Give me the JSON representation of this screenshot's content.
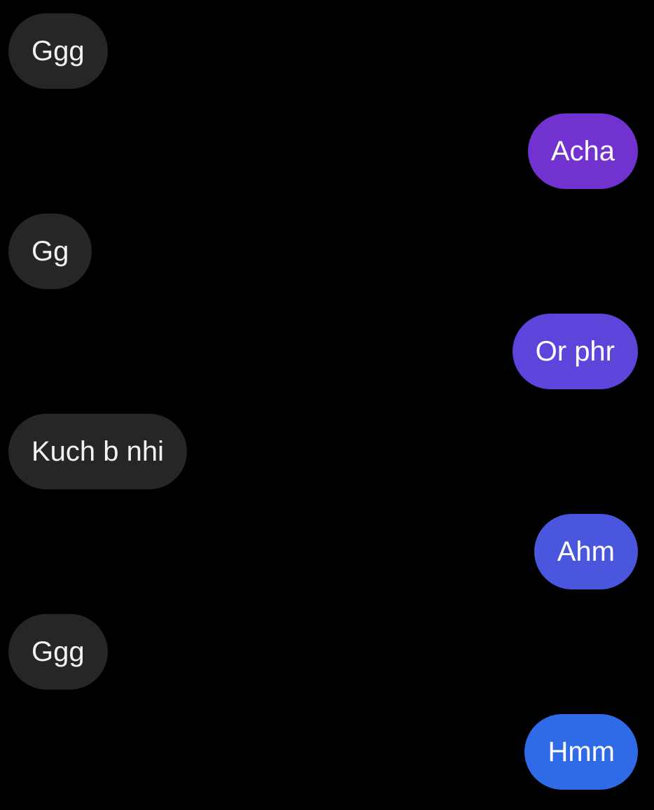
{
  "messages": [
    {
      "direction": "incoming",
      "text": "Ggg",
      "color": "#262626"
    },
    {
      "direction": "outgoing",
      "text": "Acha",
      "color": "#7232cf"
    },
    {
      "direction": "incoming",
      "text": "Gg",
      "color": "#262626"
    },
    {
      "direction": "outgoing",
      "text": "Or phr",
      "color": "#5e44da"
    },
    {
      "direction": "incoming",
      "text": "Kuch b nhi",
      "color": "#262626"
    },
    {
      "direction": "outgoing",
      "text": "Ahm",
      "color": "#4a56dd"
    },
    {
      "direction": "incoming",
      "text": "Ggg",
      "color": "#262626"
    },
    {
      "direction": "outgoing",
      "text": "Hmm",
      "color": "#2f6be6"
    }
  ]
}
